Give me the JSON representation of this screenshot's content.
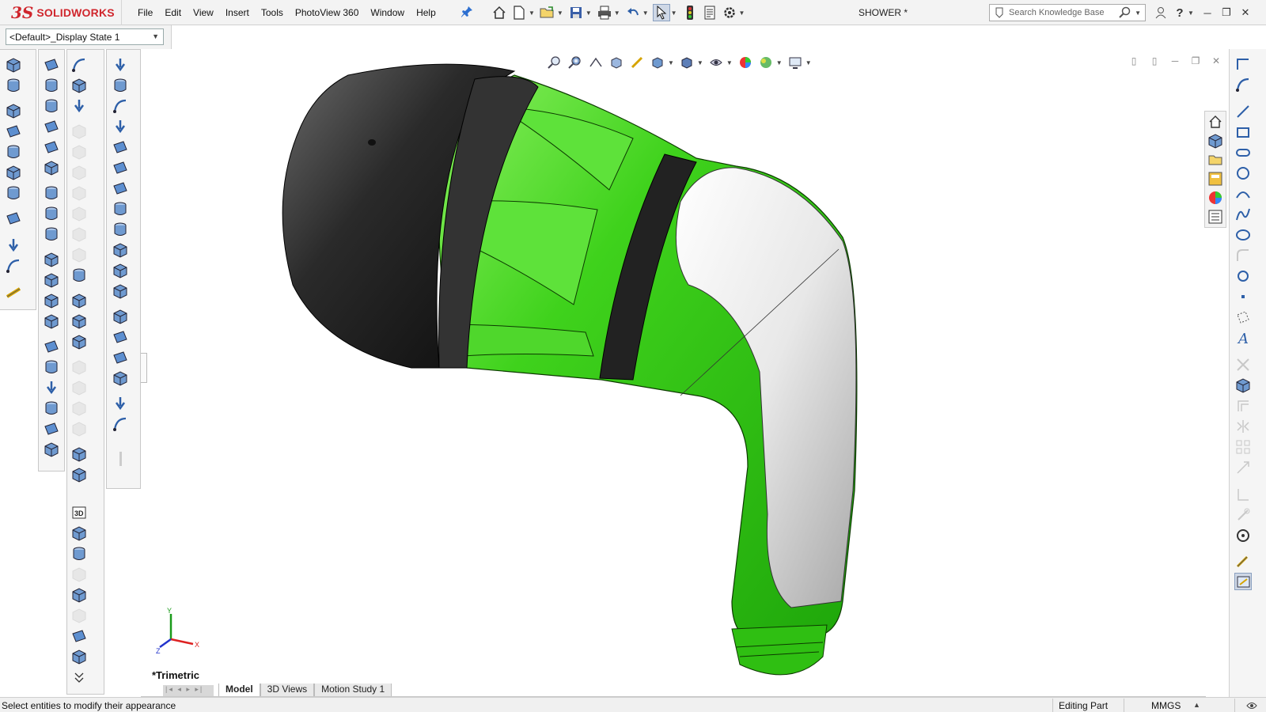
{
  "app": {
    "brand_mark": "3S",
    "brand_name": "SOLIDWORKS",
    "document_title": "SHOWER *"
  },
  "menu": [
    "File",
    "Edit",
    "View",
    "Insert",
    "Tools",
    "PhotoView 360",
    "Window",
    "Help"
  ],
  "search": {
    "placeholder": "Search Knowledge Base"
  },
  "display_state": {
    "value": "<Default>_Display State 1"
  },
  "viewport": {
    "view_label": "*Trimetric"
  },
  "triad": {
    "x": "X",
    "y": "Y",
    "z": "Z"
  },
  "tabs": {
    "model": "Model",
    "views": "3D Views",
    "motion": "Motion Study 1"
  },
  "status": {
    "message": "Select entities to modify their appearance",
    "mode": "Editing Part",
    "units": "MMGS"
  },
  "colors": {
    "accent_green": "#3fd21c",
    "brand_red": "#d0262d",
    "toolbar_bg": "#f5f5f5"
  },
  "icons": {
    "quick": [
      "home-icon",
      "new-document-icon",
      "open-folder-icon",
      "save-icon",
      "print-icon",
      "undo-icon",
      "select-pointer-icon",
      "traffic-light-icon",
      "file-properties-icon",
      "options-gear-icon"
    ],
    "heads_up": [
      "zoom-to-fit-icon",
      "zoom-area-icon",
      "previous-view-icon",
      "section-view-icon",
      "dynamic-annotation-icon",
      "view-orientation-icon",
      "display-style-icon",
      "hide-show-icon",
      "edit-appearance-icon",
      "apply-scene-icon",
      "view-settings-icon"
    ]
  }
}
